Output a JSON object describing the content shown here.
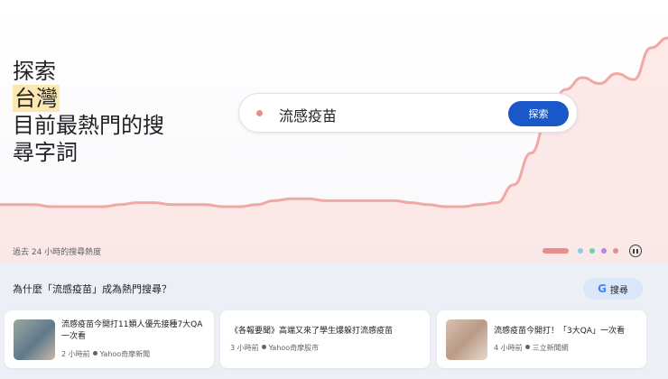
{
  "headline": {
    "line1": "探索",
    "highlight": "台灣",
    "line3": "目前最熱門的搜",
    "line4": "尋字詞"
  },
  "search": {
    "query": "流感疫苗",
    "button_label": "探索"
  },
  "trend": {
    "range_label": "過去 24 小時的搜尋熱度",
    "values": [
      16,
      16,
      16,
      15,
      15,
      15,
      15,
      16,
      17,
      17,
      16,
      16,
      16,
      15,
      15,
      16,
      18,
      19,
      19,
      18,
      18,
      18,
      18,
      18,
      17,
      16,
      15,
      15,
      16,
      17,
      26,
      42,
      60,
      74,
      80,
      77,
      82,
      79,
      95,
      100
    ],
    "line_color": "#f1a8a4",
    "fill_color": "#fbe2e0"
  },
  "carousel": {
    "dot_colors": [
      "#e88d8d",
      "#90c8ee",
      "#6ed0b0",
      "#b388e0",
      "#e88d8d"
    ],
    "active_index": 0
  },
  "why": {
    "title": "為什麼「流感疫苗」成為熱門搜尋？",
    "google_button": "搜尋"
  },
  "articles": [
    {
      "title": "流感疫苗今開打11類人優先接種7大QA一次看",
      "time": "2 小時前",
      "source": "Yahoo奇摩新聞",
      "has_thumb": true
    },
    {
      "title": "《各報要聞》高端又來了學生爆躲打流感疫苗",
      "time": "3 小時前",
      "source": "Yahoo奇摩股市",
      "has_thumb": false
    },
    {
      "title": "流感疫苗今開打！「3大QA」一次看",
      "time": "4 小時前",
      "source": "三立新聞網",
      "has_thumb": true
    }
  ]
}
